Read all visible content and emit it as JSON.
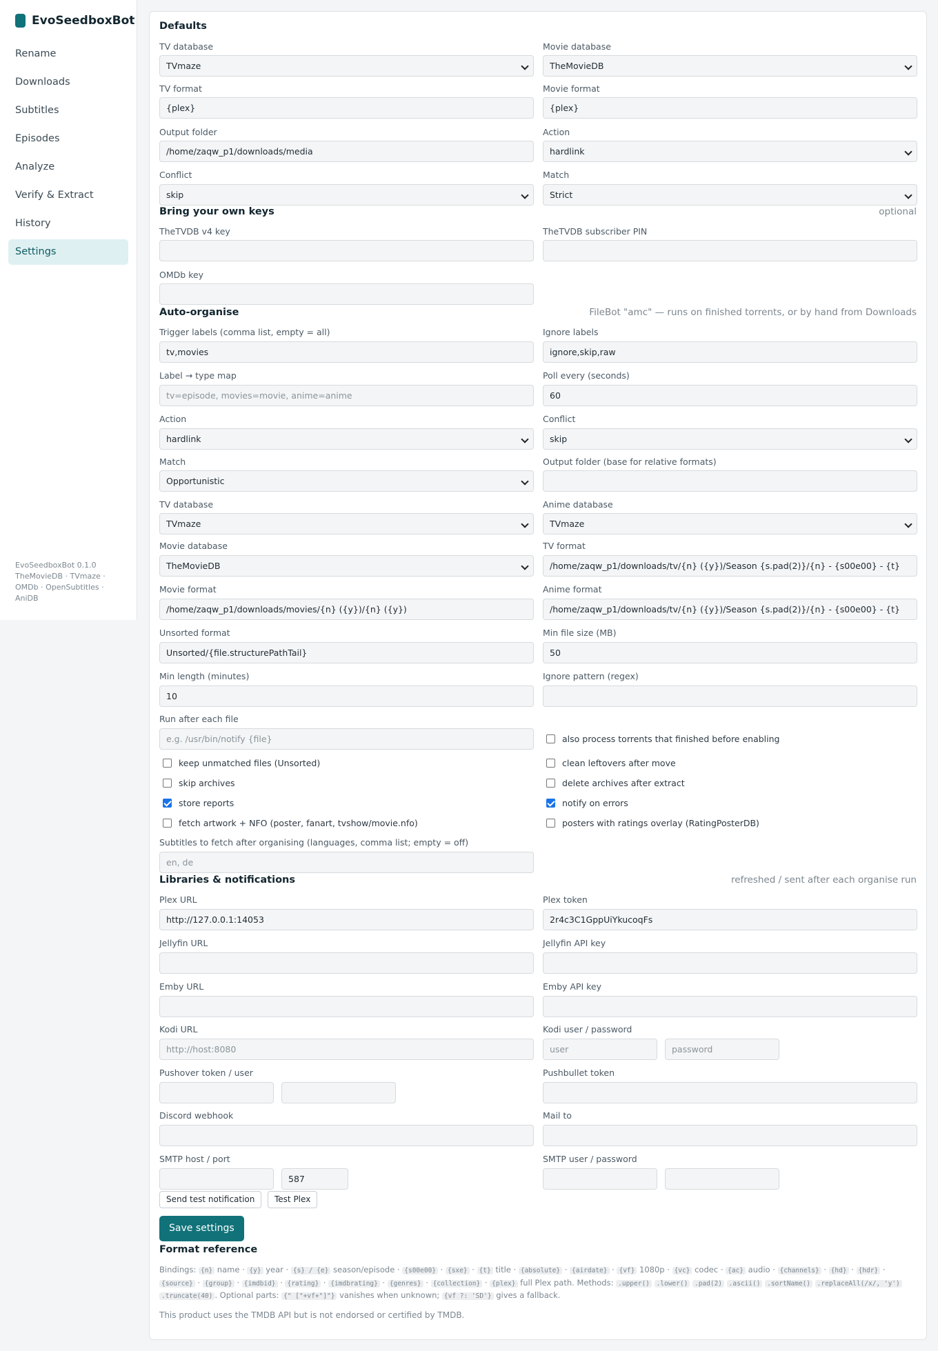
{
  "app": {
    "name": "EvoSeedboxBot"
  },
  "sidebar": {
    "items": [
      {
        "label": "Rename"
      },
      {
        "label": "Downloads"
      },
      {
        "label": "Subtitles"
      },
      {
        "label": "Episodes"
      },
      {
        "label": "Analyze"
      },
      {
        "label": "Verify & Extract"
      },
      {
        "label": "History"
      },
      {
        "label": "Settings",
        "active": true
      }
    ],
    "footer": {
      "version": "EvoSeedboxBot 0.1.0",
      "credits": "TheMovieDB · TVmaze · OMDb · OpenSubtitles · AniDB"
    }
  },
  "defaults": {
    "heading": "Defaults",
    "tv_database": {
      "label": "TV database",
      "value": "TVmaze"
    },
    "movie_database": {
      "label": "Movie database",
      "value": "TheMovieDB"
    },
    "tv_format": {
      "label": "TV format",
      "value": "{plex}"
    },
    "movie_format": {
      "label": "Movie format",
      "value": "{plex}"
    },
    "output_folder": {
      "label": "Output folder",
      "value": "/home/zaqw_p1/downloads/media"
    },
    "action": {
      "label": "Action",
      "value": "hardlink"
    },
    "conflict": {
      "label": "Conflict",
      "value": "skip"
    },
    "match": {
      "label": "Match",
      "value": "Strict"
    }
  },
  "keys": {
    "heading": "Bring your own keys",
    "hint": "optional",
    "tvdb_key": {
      "label": "TheTVDB v4 key",
      "value": ""
    },
    "tvdb_pin": {
      "label": "TheTVDB subscriber PIN",
      "value": ""
    },
    "omdb_key": {
      "label": "OMDb key",
      "value": ""
    }
  },
  "auto": {
    "heading": "Auto-organise",
    "hint": "FileBot \"amc\" — runs on finished torrents, or by hand from Downloads",
    "trigger_labels": {
      "label": "Trigger labels (comma list, empty = all)",
      "value": "tv,movies"
    },
    "ignore_labels": {
      "label": "Ignore labels",
      "value": "ignore,skip,raw"
    },
    "label_map": {
      "label": "Label → type map",
      "placeholder": "tv=episode, movies=movie, anime=anime"
    },
    "poll_every": {
      "label": "Poll every (seconds)",
      "value": "60"
    },
    "action": {
      "label": "Action",
      "value": "hardlink"
    },
    "conflict": {
      "label": "Conflict",
      "value": "skip"
    },
    "match": {
      "label": "Match",
      "value": "Opportunistic"
    },
    "output_folder": {
      "label": "Output folder (base for relative formats)",
      "value": ""
    },
    "tv_database": {
      "label": "TV database",
      "value": "TVmaze"
    },
    "anime_database": {
      "label": "Anime database",
      "value": "TVmaze"
    },
    "movie_database": {
      "label": "Movie database",
      "value": "TheMovieDB"
    },
    "tv_format": {
      "label": "TV format",
      "value": "/home/zaqw_p1/downloads/tv/{n} ({y})/Season {s.pad(2)}/{n} - {s00e00} - {t}"
    },
    "movie_format": {
      "label": "Movie format",
      "value": "/home/zaqw_p1/downloads/movies/{n} ({y})/{n} ({y})"
    },
    "anime_format": {
      "label": "Anime format",
      "value": "/home/zaqw_p1/downloads/tv/{n} ({y})/Season {s.pad(2)}/{n} - {s00e00} - {t}"
    },
    "unsorted_format": {
      "label": "Unsorted format",
      "value": "Unsorted/{file.structurePathTail}"
    },
    "min_file_size": {
      "label": "Min file size (MB)",
      "value": "50"
    },
    "min_length": {
      "label": "Min length (minutes)",
      "value": "10"
    },
    "ignore_pattern": {
      "label": "Ignore pattern (regex)",
      "value": ""
    },
    "run_after": {
      "label": "Run after each file",
      "placeholder": "e.g. /usr/bin/notify {file}"
    },
    "checks": {
      "also_process": {
        "label": "also process torrents that finished before enabling",
        "checked": false
      },
      "keep_unmatched": {
        "label": "keep unmatched files (Unsorted)",
        "checked": false
      },
      "clean_leftovers": {
        "label": "clean leftovers after move",
        "checked": false
      },
      "skip_archives": {
        "label": "skip archives",
        "checked": false
      },
      "delete_archives": {
        "label": "delete archives after extract",
        "checked": false
      },
      "store_reports": {
        "label": "store reports",
        "checked": true
      },
      "notify_errors": {
        "label": "notify on errors",
        "checked": true
      },
      "fetch_artwork": {
        "label": "fetch artwork + NFO (poster, fanart, tvshow/movie.nfo)",
        "checked": false
      },
      "posters_ratings": {
        "label": "posters with ratings overlay (RatingPosterDB)",
        "checked": false
      }
    },
    "subtitles": {
      "label": "Subtitles to fetch after organising (languages, comma list; empty = off)",
      "placeholder": "en, de"
    }
  },
  "libs": {
    "heading": "Libraries & notifications",
    "hint": "refreshed / sent after each organise run",
    "plex_url": {
      "label": "Plex URL",
      "value": "http://127.0.0.1:14053"
    },
    "plex_token": {
      "label": "Plex token",
      "value": "2r4c3C1GppUiYkucoqFs"
    },
    "jellyfin_url": {
      "label": "Jellyfin URL",
      "value": ""
    },
    "jellyfin_key": {
      "label": "Jellyfin API key",
      "value": ""
    },
    "emby_url": {
      "label": "Emby URL",
      "value": ""
    },
    "emby_key": {
      "label": "Emby API key",
      "value": ""
    },
    "kodi_url": {
      "label": "Kodi URL",
      "placeholder": "http://host:8080"
    },
    "kodi_user": {
      "label": "Kodi user / password",
      "user_placeholder": "user",
      "password_placeholder": "password"
    },
    "pushover": {
      "label": "Pushover token / user"
    },
    "pushbullet": {
      "label": "Pushbullet token"
    },
    "discord": {
      "label": "Discord webhook"
    },
    "mail_to": {
      "label": "Mail to"
    },
    "smtp_host": {
      "label": "SMTP host / port",
      "port": "587"
    },
    "smtp_user": {
      "label": "SMTP user / password"
    },
    "send_test": "Send test notification",
    "test_plex": "Test Plex"
  },
  "save_label": "Save settings",
  "reference": {
    "heading": "Format reference",
    "bindings_label": "Bindings:",
    "items": [
      {
        "code": "{n}",
        "desc": "name"
      },
      {
        "code": "{y}",
        "desc": "year"
      },
      {
        "code": "{s} / {e}",
        "desc": "season/episode"
      },
      {
        "code": "{s00e00}",
        "desc": ""
      },
      {
        "code": "{sxe}",
        "desc": ""
      },
      {
        "code": "{t}",
        "desc": "title"
      },
      {
        "code": "{absolute}",
        "desc": ""
      },
      {
        "code": "{airdate}",
        "desc": ""
      },
      {
        "code": "{vf}",
        "desc": "1080p"
      },
      {
        "code": "{vc}",
        "desc": "codec"
      },
      {
        "code": "{ac}",
        "desc": "audio"
      },
      {
        "code": "{channels}",
        "desc": ""
      },
      {
        "code": "{hd}",
        "desc": ""
      },
      {
        "code": "{hdr}",
        "desc": ""
      },
      {
        "code": "{source}",
        "desc": ""
      },
      {
        "code": "{group}",
        "desc": ""
      },
      {
        "code": "{imdbid}",
        "desc": ""
      },
      {
        "code": "{rating}",
        "desc": ""
      },
      {
        "code": "{imdbrating}",
        "desc": ""
      },
      {
        "code": "{genres}",
        "desc": ""
      },
      {
        "code": "{collection}",
        "desc": ""
      },
      {
        "code": "{plex}",
        "desc": "full Plex path."
      }
    ],
    "methods_label": "Methods:",
    "methods": [
      ".upper()",
      ".lower()",
      ".pad(2)",
      ".ascii()",
      ".sortName()",
      ".replaceAll(/x/, 'y')",
      ".truncate(40)"
    ],
    "optional_label": "Optional parts:",
    "optional_code": "{\" [\"+vf+\"]\"}",
    "optional_desc": "vanishes when unknown;",
    "fallback_code": "{vf ?: 'SD'}",
    "fallback_desc": "gives a fallback.",
    "tmdb_notice": "This product uses the TMDB API but is not endorsed or certified by TMDB."
  }
}
